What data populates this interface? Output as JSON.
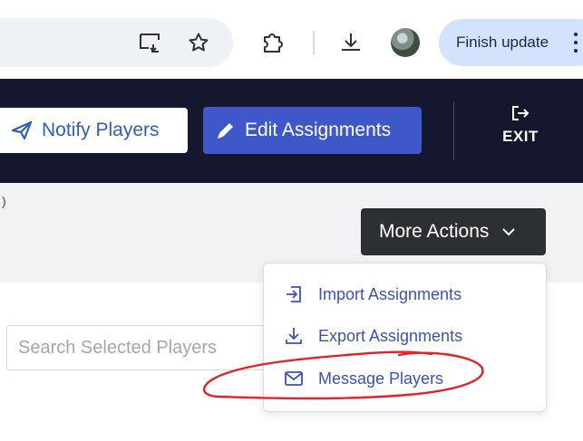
{
  "browser": {
    "finish_update_label": "Finish update",
    "icons": [
      "cast-icon",
      "star-icon",
      "extensions-icon",
      "download-icon",
      "profile-avatar",
      "more-vert-icon"
    ]
  },
  "header": {
    "notify_label": "Notify Players",
    "edit_label": "Edit Assignments",
    "exit_label": "EXIT",
    "colors": {
      "bar": "#15172f",
      "edit_button": "#3f58c9",
      "notify_text": "#2f5fb6"
    }
  },
  "actions": {
    "more_label": "More Actions"
  },
  "search": {
    "placeholder": "Search Selected Players"
  },
  "menu": {
    "items": [
      {
        "label": "Import Assignments",
        "icon": "import-icon"
      },
      {
        "label": "Export Assignments",
        "icon": "export-icon"
      },
      {
        "label": "Message Players",
        "icon": "mail-icon"
      }
    ],
    "accent": "#3a52b8"
  },
  "annotation": {
    "color": "#e2232a",
    "target": "Message Players"
  }
}
